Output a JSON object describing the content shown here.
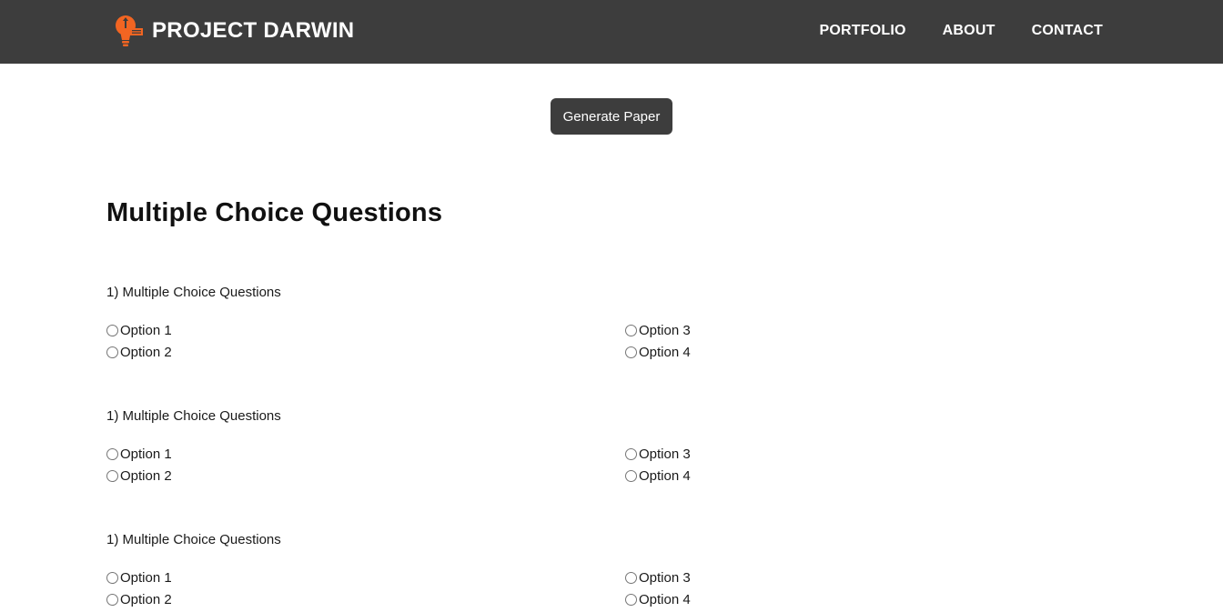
{
  "nav": {
    "brand": "PROJECT DARWIN",
    "links": [
      "PORTFOLIO",
      "ABOUT",
      "CONTACT"
    ]
  },
  "generate_button": "Generate Paper",
  "section_title": "Multiple Choice Questions",
  "questions": [
    {
      "text": "1) Multiple Choice Questions",
      "options": [
        "Option 1",
        "Option 2",
        "Option 3",
        "Option 4"
      ]
    },
    {
      "text": "1) Multiple Choice Questions",
      "options": [
        "Option 1",
        "Option 2",
        "Option 3",
        "Option 4"
      ]
    },
    {
      "text": "1) Multiple Choice Questions",
      "options": [
        "Option 1",
        "Option 2",
        "Option 3",
        "Option 4"
      ]
    }
  ],
  "colors": {
    "navbar": "#3d3d3d",
    "logo_accent": "#f26522",
    "button": "#3d3d3d",
    "text": "#1a1a1a"
  }
}
